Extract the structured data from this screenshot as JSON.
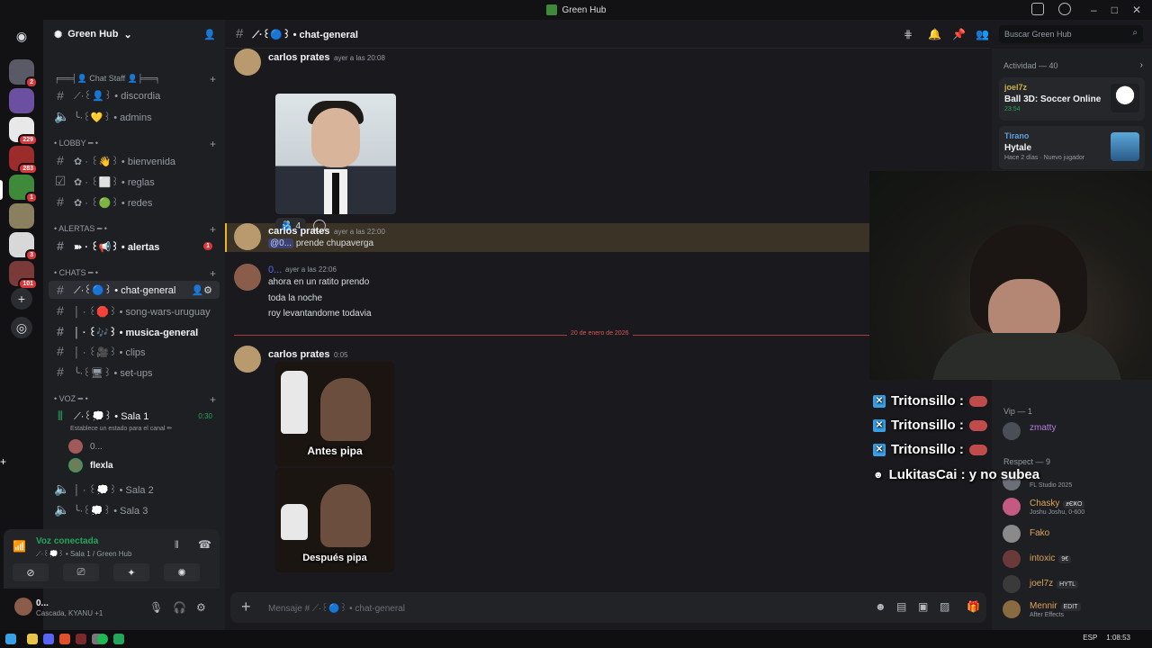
{
  "window": {
    "title": "Green Hub"
  },
  "server": {
    "name": "Green Hub"
  },
  "guild_badges": [
    "2",
    "229",
    "283",
    "1",
    "3",
    "101"
  ],
  "categories": {
    "staff": "╒══╡👤 Chat Staff 👤╞══╕",
    "lobby": "• LOBBY ━ •",
    "alertas": "• ALERTAS ━ •",
    "chats": "• CHATS ━ •",
    "voz": "• VOZ ━ •"
  },
  "channels": {
    "discordia": "⟋·꒰👤꒱ • discordia",
    "admins": "╰·꒰💛꒱ • admins",
    "bienvenida": "✿ · ꒰👋꒱ • bienvenida",
    "reglas": "✿ · ꒰⬜꒱ • reglas",
    "redes": "✿ · ꒰🟢꒱ • redes",
    "alertas": "➽ · ꒰📢꒱ • alertas",
    "alertas_badge": "1",
    "chat_general": "⟋·꒰🔵꒱ • chat-general",
    "song_wars": "│ · ꒰🛑꒱ • song-wars-uruguay",
    "musica": "│ · ꒰🎶꒱ • musica-general",
    "clips": "│ · ꒰🎥꒱ • clips",
    "setups": "╰·꒰🖥꒱ • set-ups",
    "sala1": "⟋·꒰💭꒱ • Sala 1",
    "sala1_time": "0:30",
    "sala1_status": "Establece un estado para el canal ✏",
    "sala2": "│ · ꒰💭꒱ • Sala 2",
    "sala3": "╰·꒰💭꒱ • Sala 3"
  },
  "voice_users": [
    "0...",
    "flexla"
  ],
  "voice_panel": {
    "status": "Voz conectada",
    "sub": "⟋·꒰💭꒱ • Sala 1 / Green Hub"
  },
  "user": {
    "name": "0...",
    "status": "Cascada, KYANU +1"
  },
  "header": {
    "channel": "⟋·꒰🔵꒱ • chat-general",
    "search_placeholder": "Buscar Green Hub"
  },
  "messages": [
    {
      "author": "carlos prates",
      "time": "ayer a las 20:08",
      "reaction_count": "4"
    },
    {
      "author": "carlos prates",
      "time": "ayer a las 22:00",
      "mention": "@0...",
      "text": "prende chupaverga"
    },
    {
      "author": "0...",
      "time": "ayer a las 22:06",
      "lines": [
        "ahora en un ratito prendo",
        "toda la noche",
        "roy levantandome todavia"
      ]
    },
    {
      "author": "carlos prates",
      "time": "0:05",
      "captions": [
        "Antes pipa",
        "Después pipa"
      ]
    }
  ],
  "date_divider": "20 de enero de 2026",
  "composer": {
    "placeholder": "Mensaje # ⟋·꒰🔵꒱ • chat-general"
  },
  "activity": {
    "header": "Actividad — 40",
    "cards": [
      {
        "user": "joel7z",
        "game": "Ball 3D: Soccer Online",
        "time": "23:54"
      },
      {
        "user": "Tirano",
        "game": "Hytale",
        "time": "Hace 2 días",
        "extra": "Nuevo jugador"
      }
    ]
  },
  "overlay": {
    "lines": [
      "Tritonsillo :",
      "Tritonsillo :",
      "Tritonsillo :"
    ],
    "last": "LukitasCai : y no subea"
  },
  "members": {
    "vip_header": "Vip — 1",
    "respect_header": "Respect — 9",
    "vip": [
      {
        "name": "zmatty"
      }
    ],
    "respect": [
      {
        "name": "",
        "sub": "FL Studio 2025"
      },
      {
        "name": "Chasky",
        "tag": "ƶЄҜO",
        "sub": "Joshu Joshu, 0-600"
      },
      {
        "name": "Fako"
      },
      {
        "name": "intoxic",
        "tag": "9€"
      },
      {
        "name": "joel7z",
        "tag": "HYTL"
      },
      {
        "name": "Mennir",
        "tag": "EDIT",
        "sub": "After Effects"
      }
    ]
  },
  "taskbar": {
    "lang": "ESP",
    "time": "1:08:53"
  },
  "colors": {
    "accent_green": "#23a55a",
    "mention_bg": "#3c4270",
    "highlight": "#f0b232",
    "danger": "#da373c"
  }
}
